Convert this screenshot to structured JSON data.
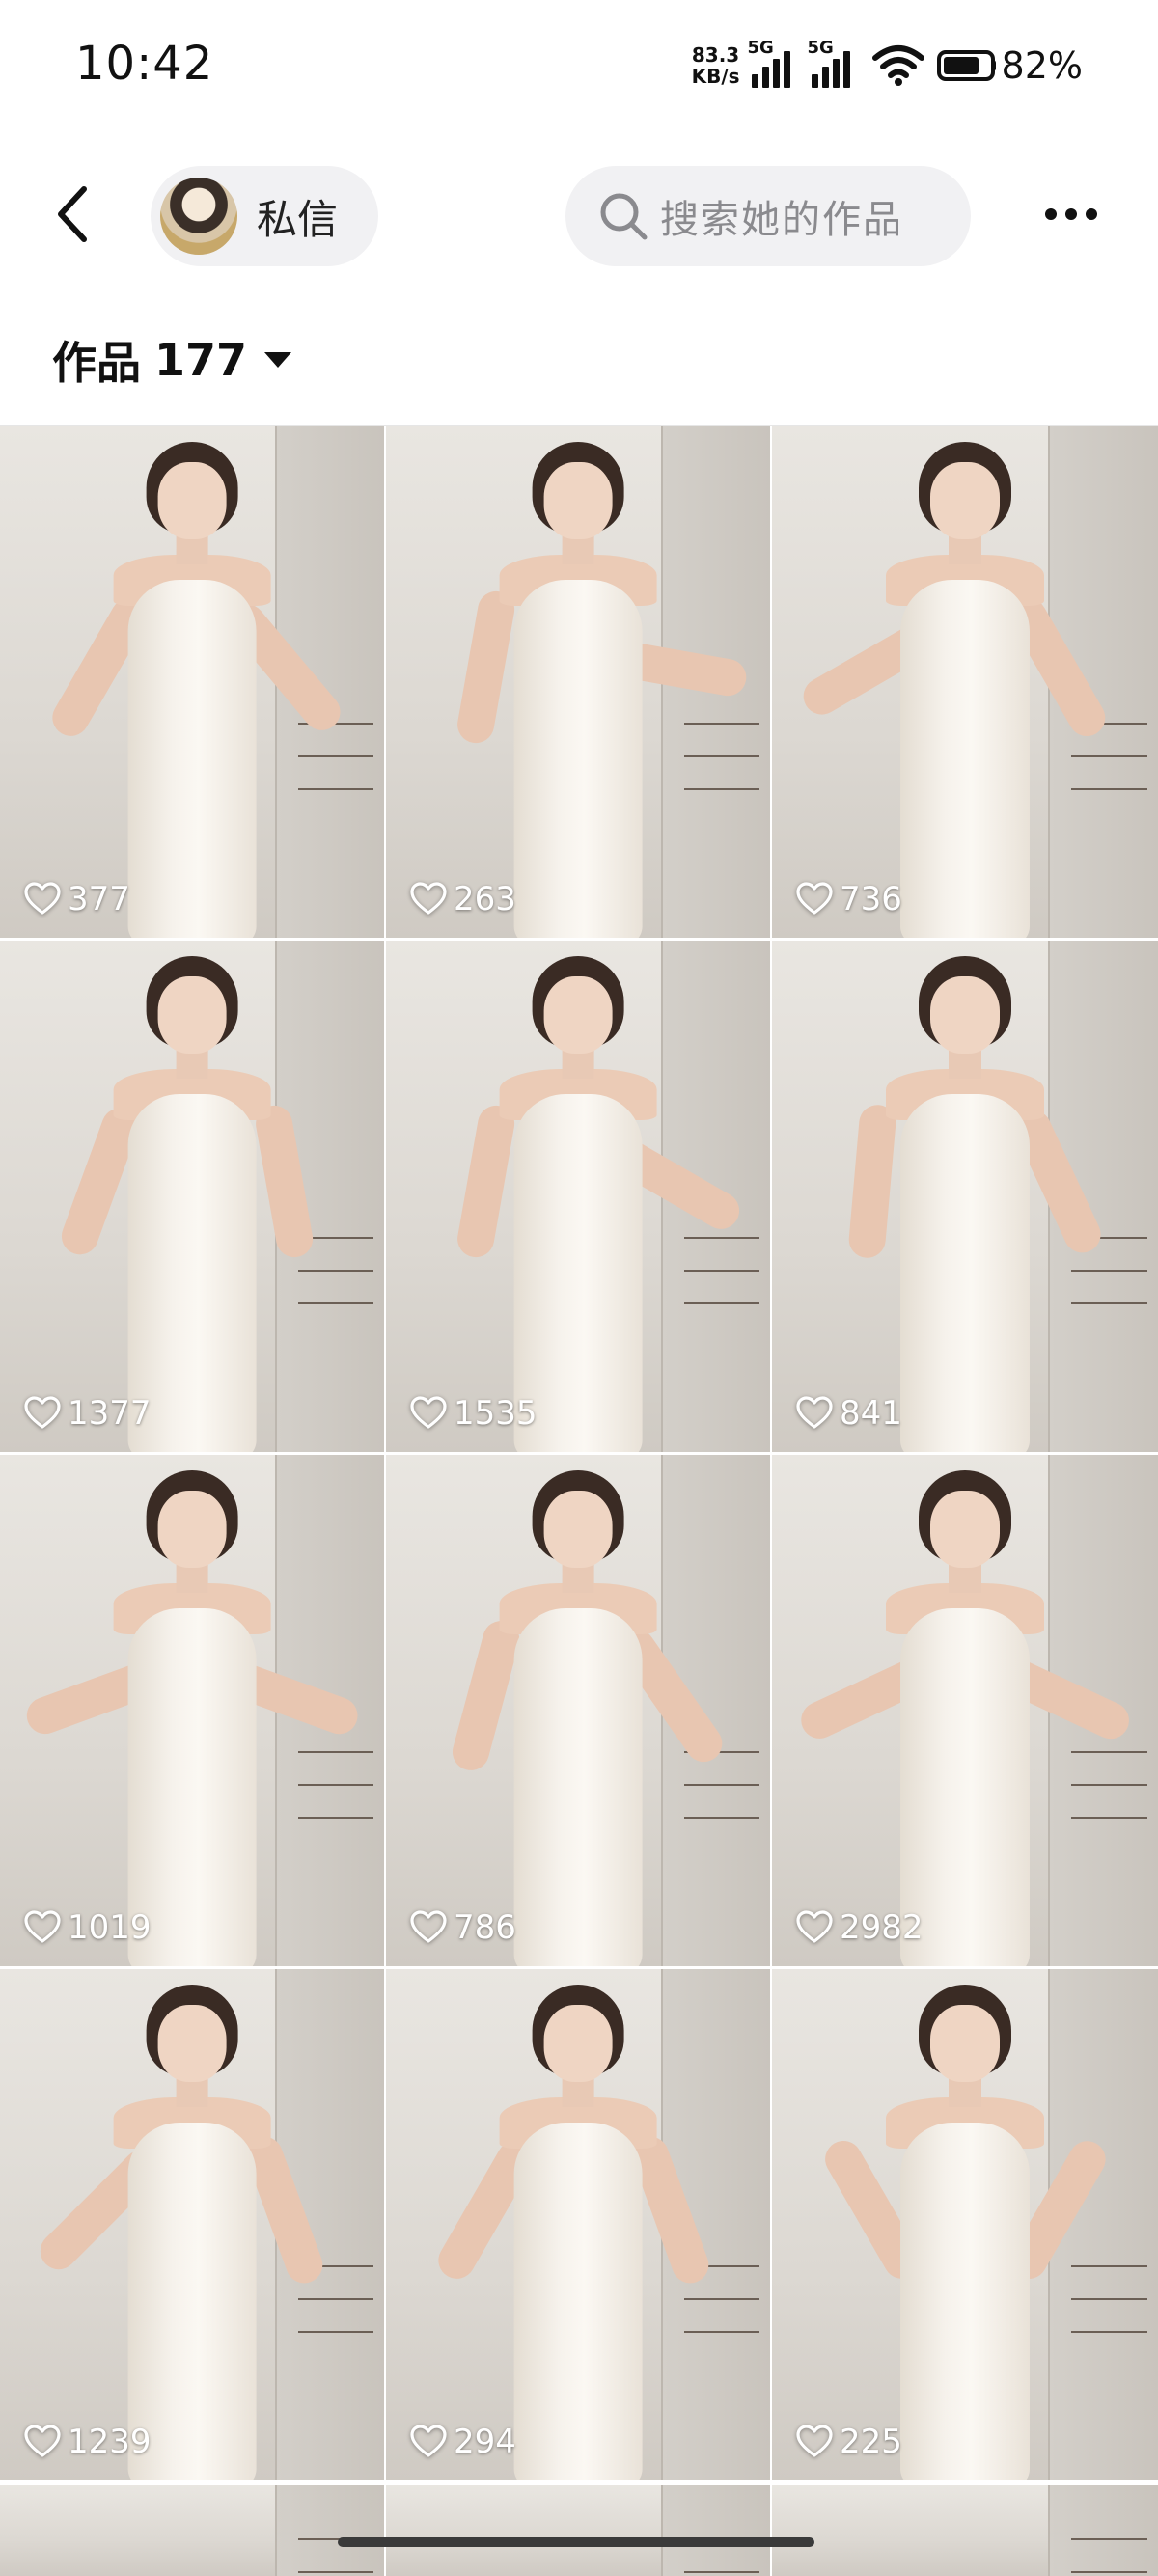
{
  "status_bar": {
    "time": "10:42",
    "net_speed_value": "83.3",
    "net_speed_unit": "KB/s",
    "signal_1_label": "5G",
    "signal_2_label": "5G",
    "battery_percent": "82%",
    "battery_level": 0.82
  },
  "header": {
    "back_icon": "chevron-left-icon",
    "dm_label": "私信",
    "search_placeholder": "搜索她的作品",
    "search_icon": "search-icon",
    "more_icon": "more-horizontal-icon"
  },
  "works": {
    "title": "作品",
    "count": "177",
    "dropdown_icon": "caret-down-icon"
  },
  "grid": {
    "items": [
      {
        "likes": "377"
      },
      {
        "likes": "263"
      },
      {
        "likes": "736"
      },
      {
        "likes": "1377"
      },
      {
        "likes": "1535"
      },
      {
        "likes": "841"
      },
      {
        "likes": "1019"
      },
      {
        "likes": "786"
      },
      {
        "likes": "2982"
      },
      {
        "likes": "1239"
      },
      {
        "likes": "294"
      },
      {
        "likes": "225"
      }
    ],
    "like_icon": "heart-outline-icon"
  }
}
